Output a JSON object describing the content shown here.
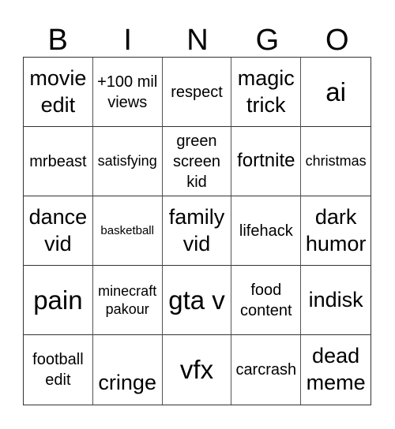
{
  "header": [
    "B",
    "I",
    "N",
    "G",
    "O"
  ],
  "cells": [
    "movie edit",
    "+100 mil views",
    "respect",
    "magic trick",
    "ai",
    "mrbeast",
    "satisfying",
    "green screen kid",
    "fortnite",
    "christmas",
    "dance vid",
    "basketball",
    "family vid",
    "lifehack",
    "dark humor",
    "pain",
    "minecraft pakour",
    "gta v",
    "food content",
    "indisk",
    "football edit",
    "cringe",
    "vfx",
    "carcrash",
    "dead meme"
  ]
}
